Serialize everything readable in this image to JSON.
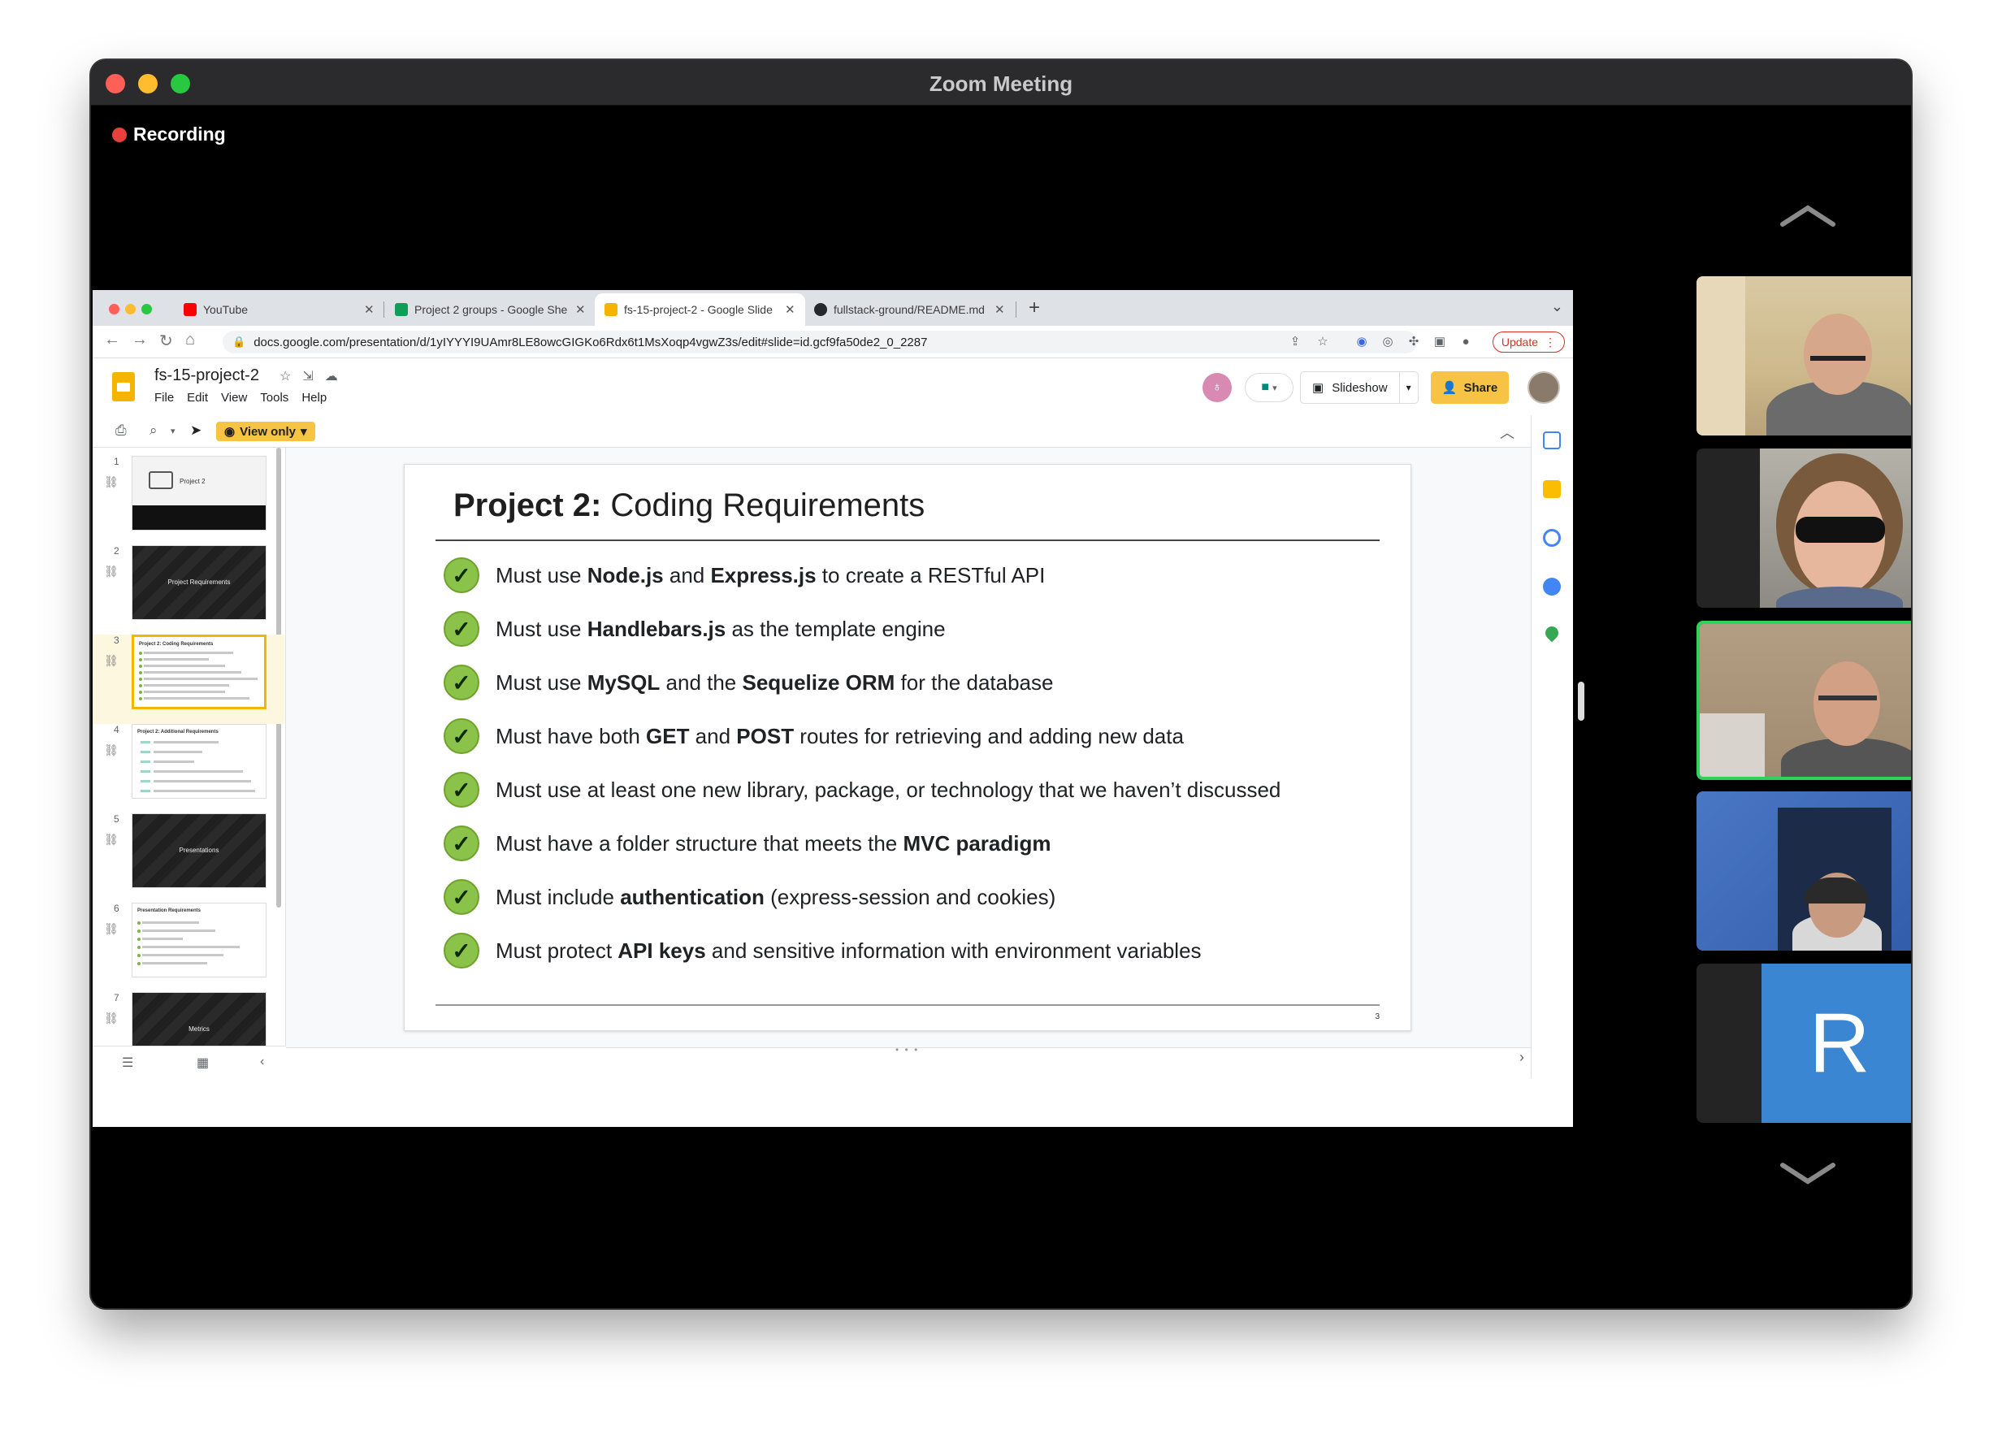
{
  "zoom": {
    "window_title": "Zoom Meeting",
    "recording_label": "Recording",
    "participant_initial": "R"
  },
  "browser": {
    "tabs": [
      {
        "title": "YouTube",
        "favicon": "youtube-icon"
      },
      {
        "title": "Project 2 groups - Google She",
        "favicon": "google-sheets-icon"
      },
      {
        "title": "fs-15-project-2 - Google Slide",
        "favicon": "google-slides-icon"
      },
      {
        "title": "fullstack-ground/README.md",
        "favicon": "github-icon"
      }
    ],
    "url": "docs.google.com/presentation/d/1yIYYYI9UAmr8LE8owcGIGKo6Rdx6t1MsXoqp4vgwZ3s/edit#slide=id.gcf9fa50de2_0_2287",
    "update_label": "Update"
  },
  "slides_app": {
    "doc_title": "fs-15-project-2",
    "menus": [
      "File",
      "Edit",
      "View",
      "Tools",
      "Help"
    ],
    "slideshow_label": "Slideshow",
    "share_label": "Share",
    "view_only_label": "View only"
  },
  "filmstrip": {
    "thumbnails": [
      {
        "num": "1",
        "caption": "Project 2"
      },
      {
        "num": "2",
        "caption": "Project Requirements"
      },
      {
        "num": "3",
        "caption": ""
      },
      {
        "num": "4",
        "caption": ""
      },
      {
        "num": "5",
        "caption": "Presentations"
      },
      {
        "num": "6",
        "caption": ""
      },
      {
        "num": "7",
        "caption": "Metrics"
      }
    ]
  },
  "slide": {
    "title_bold": "Project 2:",
    "title_rest": " Coding Requirements",
    "page_number": "3",
    "requirements": [
      [
        {
          "t": "Must use "
        },
        {
          "b": "Node.js"
        },
        {
          "t": " and "
        },
        {
          "b": "Express.js"
        },
        {
          "t": " to create a RESTful API"
        }
      ],
      [
        {
          "t": "Must use "
        },
        {
          "b": "Handlebars.js"
        },
        {
          "t": " as the template engine"
        }
      ],
      [
        {
          "t": "Must use "
        },
        {
          "b": "MySQL"
        },
        {
          "t": " and the "
        },
        {
          "b": "Sequelize ORM"
        },
        {
          "t": " for the database"
        }
      ],
      [
        {
          "t": "Must have both "
        },
        {
          "b": "GET"
        },
        {
          "t": " and "
        },
        {
          "b": "POST"
        },
        {
          "t": " routes for retrieving and adding new data"
        }
      ],
      [
        {
          "t": "Must use at least one new library, package, or technology that we haven’t discussed"
        }
      ],
      [
        {
          "t": "Must have a folder structure that meets the "
        },
        {
          "b": "MVC paradigm"
        }
      ],
      [
        {
          "t": "Must include "
        },
        {
          "b": "authentication"
        },
        {
          "t": " (express-session and cookies)"
        }
      ],
      [
        {
          "t": "Must protect "
        },
        {
          "b": "API keys"
        },
        {
          "t": " and sensitive information with environment variables"
        }
      ]
    ]
  },
  "colors": {
    "check_green": "#8bc34a",
    "slides_yellow": "#f6c344",
    "active_speaker_border": "#2fd25b",
    "record_red": "#e8413b"
  }
}
